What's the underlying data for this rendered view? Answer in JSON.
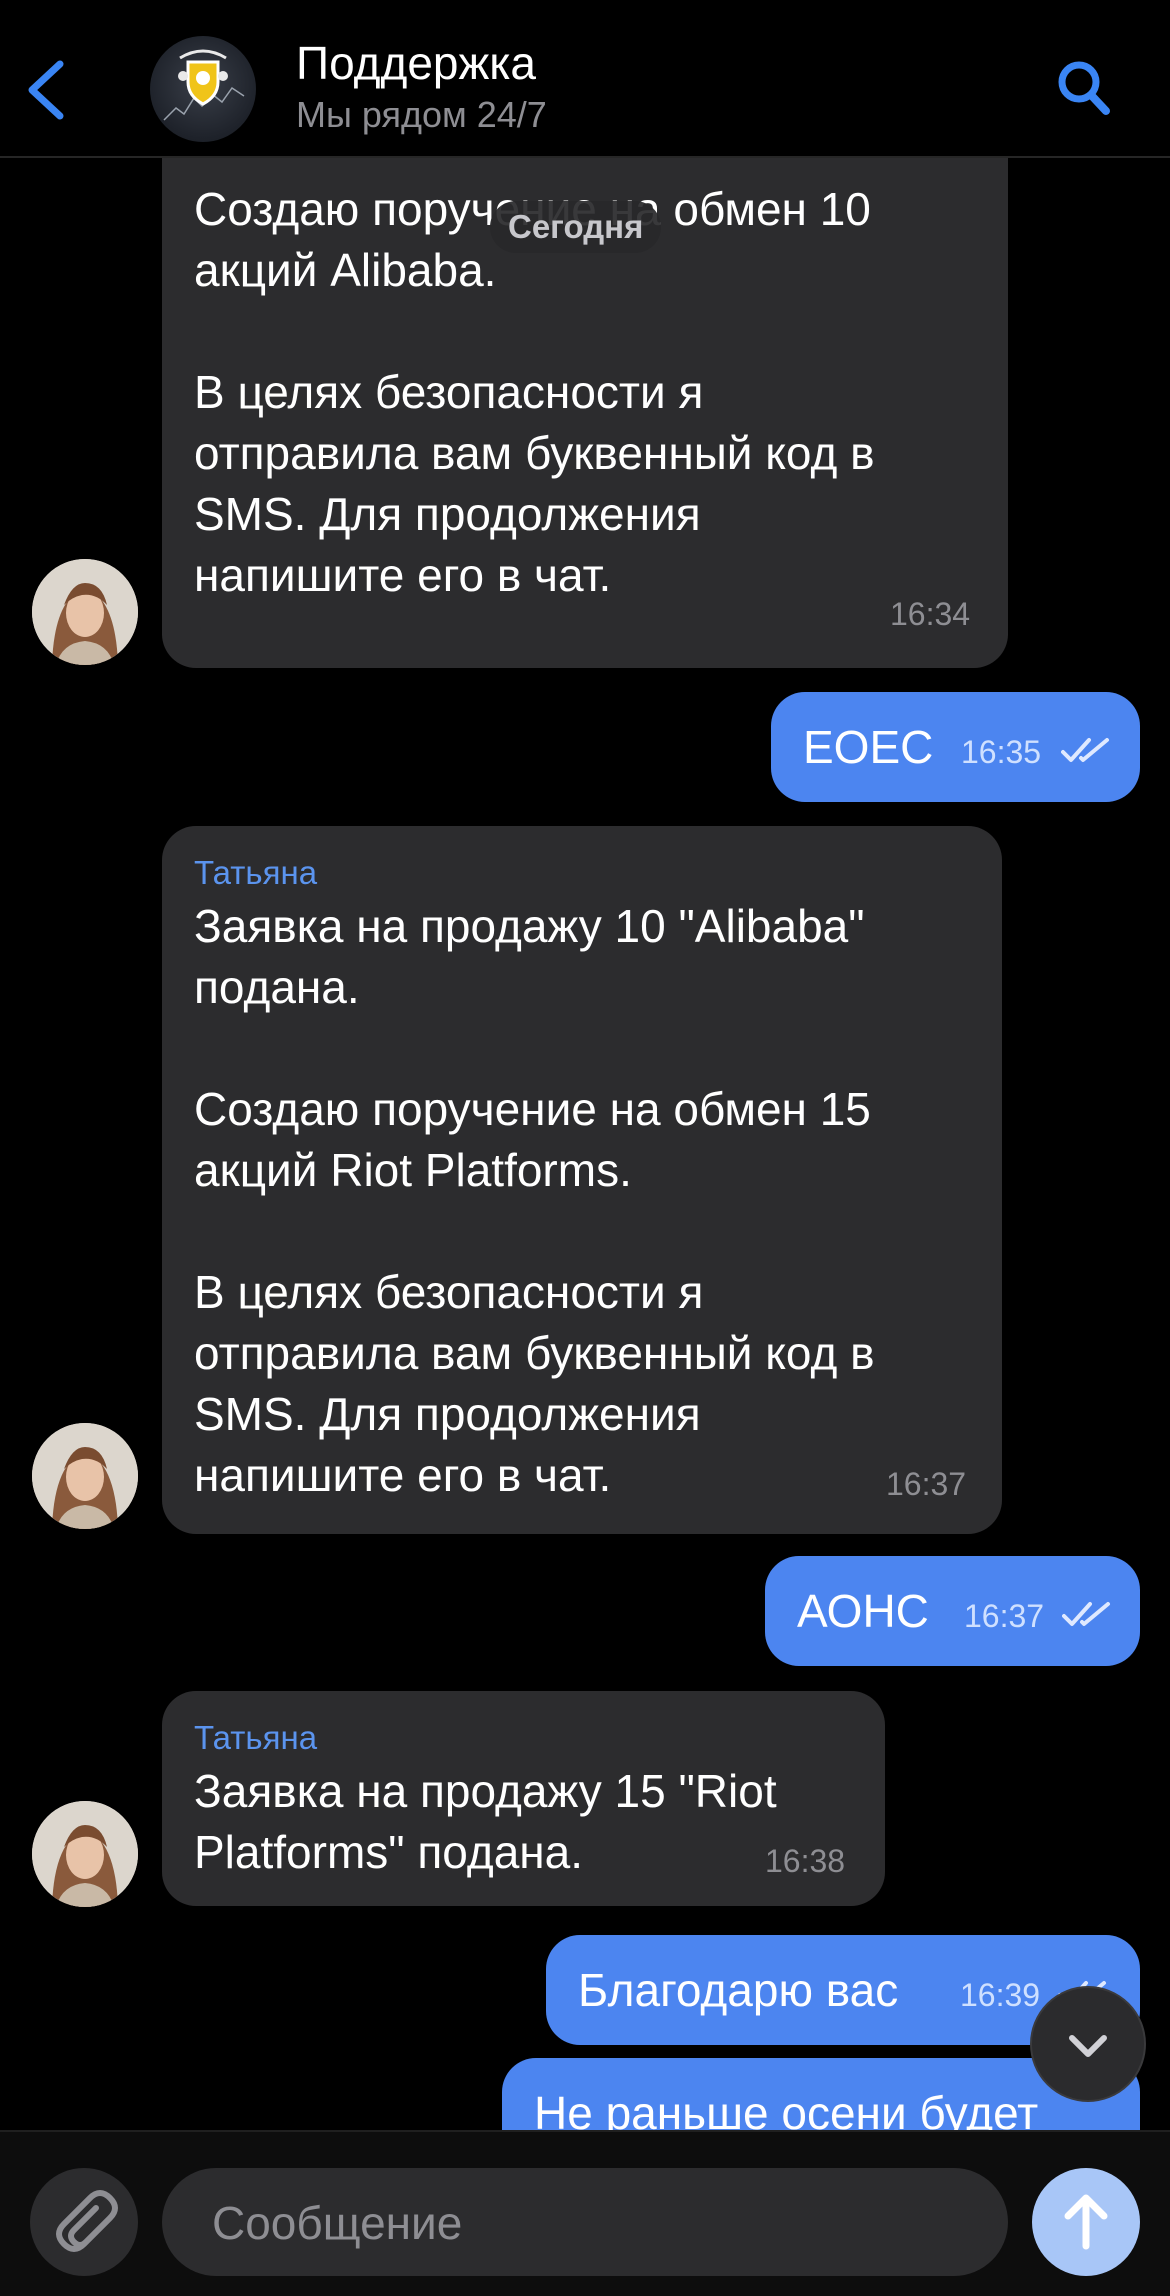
{
  "header": {
    "title": "Поддержка",
    "subtitle": "Мы рядом 24/7",
    "back_icon": "chevron-left-icon",
    "search_icon": "search-icon",
    "accent": "#3a85f4"
  },
  "date_divider": "Сегодня",
  "messages": [
    {
      "direction": "in",
      "sender": "",
      "text": "Создаю поручение на обмен 10\nакций Alibaba.\n\nВ целях безопасности я\nотправила вам буквенный код в\nSMS. Для продолжения\nнапишите его в чат.",
      "time": "16:34"
    },
    {
      "direction": "out",
      "text": "EOEC",
      "time": "16:35",
      "status": "read"
    },
    {
      "direction": "in",
      "sender": "Татьяна",
      "text": "Заявка на продажу 10 \"Alibaba\"\nподана.\n\nСоздаю поручение на обмен 15\nакций Riot Platforms.\n\nВ целях безопасности я\nотправила вам буквенный код в\nSMS. Для продолжения\nнапишите его в чат.",
      "time": "16:37"
    },
    {
      "direction": "out",
      "text": "АОНС",
      "time": "16:37",
      "status": "read"
    },
    {
      "direction": "in",
      "sender": "Татьяна",
      "text": "Заявка на продажу 15 \"Riot\nPlatforms\" подана.",
      "time": "16:38"
    },
    {
      "direction": "out",
      "text": "Благодарю вас",
      "time": "16:39",
      "status": "read"
    },
    {
      "direction": "out",
      "text": "Не раньше осени будет",
      "time": "",
      "status": ""
    }
  ],
  "composer": {
    "placeholder": "Сообщение",
    "attach_icon": "paperclip-icon",
    "send_icon": "arrow-up-icon",
    "scroll_down_icon": "chevron-down-icon"
  },
  "colors": {
    "incoming_bubble": "#2c2c2e",
    "outgoing_bubble": "#4c85f0",
    "sender_name": "#5b94ee",
    "send_button": "#a8c6f7"
  }
}
